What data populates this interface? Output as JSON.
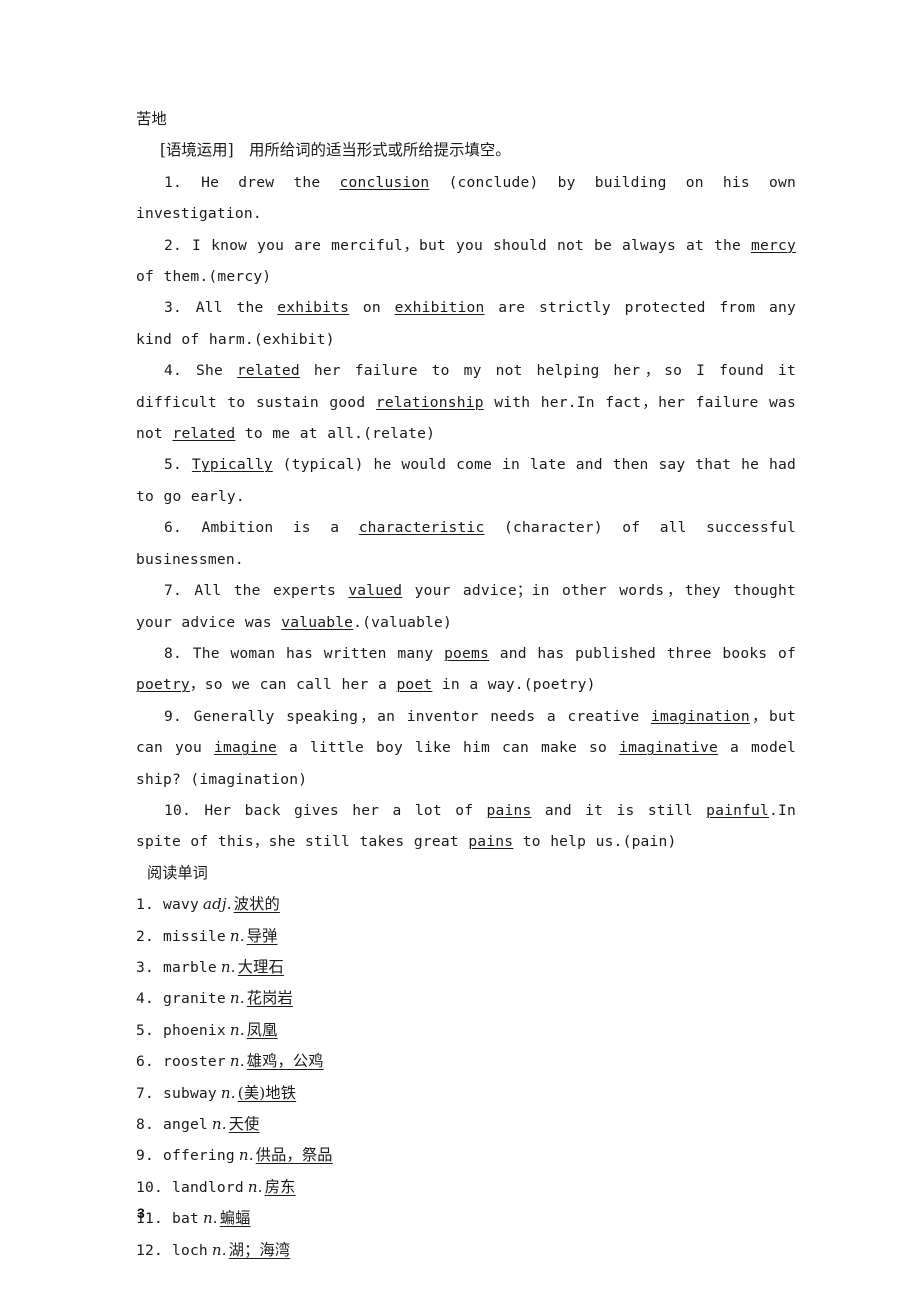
{
  "document": {
    "page_number": "3",
    "orphan_text": "苦地",
    "section_label": "[语境运用]",
    "section_instruction": "用所给词的适当形式或所给提示填空。",
    "vocab_heading": "阅读单词"
  },
  "exercises": [
    {
      "num": "1.",
      "parts": [
        {
          "t": "He drew the ",
          "u": false
        },
        {
          "t": "conclusion",
          "u": true
        },
        {
          "t": " (conclude) by building on his own investigation.",
          "u": false
        }
      ]
    },
    {
      "num": "2.",
      "parts": [
        {
          "t": "I know you are merciful，but you should not be always at the ",
          "u": false
        },
        {
          "t": "mercy",
          "u": true
        },
        {
          "t": " of them.(mercy)",
          "u": false
        }
      ]
    },
    {
      "num": "3.",
      "parts": [
        {
          "t": "All the ",
          "u": false
        },
        {
          "t": "exhibits",
          "u": true
        },
        {
          "t": " on ",
          "u": false
        },
        {
          "t": "exhibition",
          "u": true
        },
        {
          "t": " are strictly protected from any kind of harm.(exhibit)",
          "u": false
        }
      ]
    },
    {
      "num": "4.",
      "parts": [
        {
          "t": "She ",
          "u": false
        },
        {
          "t": "related",
          "u": true
        },
        {
          "t": " her failure to my not helping her，so I found it difficult to sustain good ",
          "u": false
        },
        {
          "t": "relationship",
          "u": true
        },
        {
          "t": " with her.In fact，her failure was not ",
          "u": false
        },
        {
          "t": "related",
          "u": true
        },
        {
          "t": " to me at all.(relate)",
          "u": false
        }
      ]
    },
    {
      "num": "5.",
      "parts": [
        {
          "t": "Typically",
          "u": true
        },
        {
          "t": " (typical) he would come in late and then say that he had to go early.",
          "u": false
        }
      ]
    },
    {
      "num": "6.",
      "parts": [
        {
          "t": "Ambition is a ",
          "u": false
        },
        {
          "t": "characteristic",
          "u": true
        },
        {
          "t": " (character) of all successful businessmen.",
          "u": false
        }
      ]
    },
    {
      "num": "7.",
      "parts": [
        {
          "t": "All the experts ",
          "u": false
        },
        {
          "t": "valued",
          "u": true
        },
        {
          "t": " your advice；in other words，they thought your advice was ",
          "u": false
        },
        {
          "t": "valuable",
          "u": true
        },
        {
          "t": ".(valuable)",
          "u": false
        }
      ]
    },
    {
      "num": "8.",
      "parts": [
        {
          "t": "The woman has written many ",
          "u": false
        },
        {
          "t": "poems",
          "u": true
        },
        {
          "t": " and has published three books of ",
          "u": false
        },
        {
          "t": "poetry",
          "u": true
        },
        {
          "t": "，so we can call her a ",
          "u": false
        },
        {
          "t": "poet",
          "u": true
        },
        {
          "t": " in a way.(poetry)",
          "u": false
        }
      ]
    },
    {
      "num": "9.",
      "parts": [
        {
          "t": "Generally speaking，an inventor needs a creative ",
          "u": false
        },
        {
          "t": "imagination",
          "u": true
        },
        {
          "t": "，but can you ",
          "u": false
        },
        {
          "t": "imagine",
          "u": true
        },
        {
          "t": " a little boy like him can make so ",
          "u": false
        },
        {
          "t": "imaginative",
          "u": true
        },
        {
          "t": " a model ship? (imagination)",
          "u": false
        }
      ]
    },
    {
      "num": "10.",
      "parts": [
        {
          "t": "Her back gives her a lot of ",
          "u": false
        },
        {
          "t": "pains",
          "u": true
        },
        {
          "t": " and it is still ",
          "u": false
        },
        {
          "t": "painful",
          "u": true
        },
        {
          "t": ".In spite of this，she still takes great ",
          "u": false
        },
        {
          "t": "pains",
          "u": true
        },
        {
          "t": " to help us.(pain)",
          "u": false
        }
      ]
    }
  ],
  "vocabulary": [
    {
      "num": "1.",
      "word": "wavy",
      "pos": "adj.",
      "gloss": "波状的"
    },
    {
      "num": "2.",
      "word": "missile",
      "pos": "n.",
      "gloss": "导弹"
    },
    {
      "num": "3.",
      "word": "marble",
      "pos": "n.",
      "gloss": "大理石"
    },
    {
      "num": "4.",
      "word": "granite",
      "pos": "n.",
      "gloss": "花岗岩"
    },
    {
      "num": "5.",
      "word": "phoenix",
      "pos": "n.",
      "gloss": "凤凰"
    },
    {
      "num": "6.",
      "word": "rooster",
      "pos": "n.",
      "gloss": "雄鸡，公鸡"
    },
    {
      "num": "7.",
      "word": "subway",
      "pos": "n.",
      "gloss": "(美)地铁"
    },
    {
      "num": "8.",
      "word": "angel",
      "pos": "n.",
      "gloss": "天使"
    },
    {
      "num": "9.",
      "word": "offering",
      "pos": "n.",
      "gloss": "供品，祭品"
    },
    {
      "num": "10.",
      "word": "landlord",
      "pos": "n.",
      "gloss": "房东"
    },
    {
      "num": "11.",
      "word": "bat",
      "pos": "n.",
      "gloss": "蝙蝠"
    },
    {
      "num": "12.",
      "word": "loch",
      "pos": "n.",
      "gloss": "湖；海湾"
    }
  ]
}
